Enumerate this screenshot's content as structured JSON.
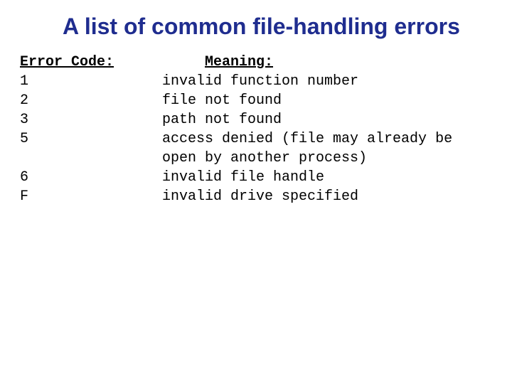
{
  "title": "A list of common file-handling errors",
  "headers": {
    "code": "Error Code:",
    "meaning": "Meaning:"
  },
  "rows": [
    {
      "code": "1",
      "meaning": "invalid function number"
    },
    {
      "code": "2",
      "meaning": "file not found"
    },
    {
      "code": "3",
      "meaning": "path not found"
    },
    {
      "code": "5",
      "meaning": "access denied (file may already be open by another process)"
    },
    {
      "code": "6",
      "meaning": "invalid file handle"
    },
    {
      "code": "F",
      "meaning": "invalid drive specified"
    }
  ]
}
